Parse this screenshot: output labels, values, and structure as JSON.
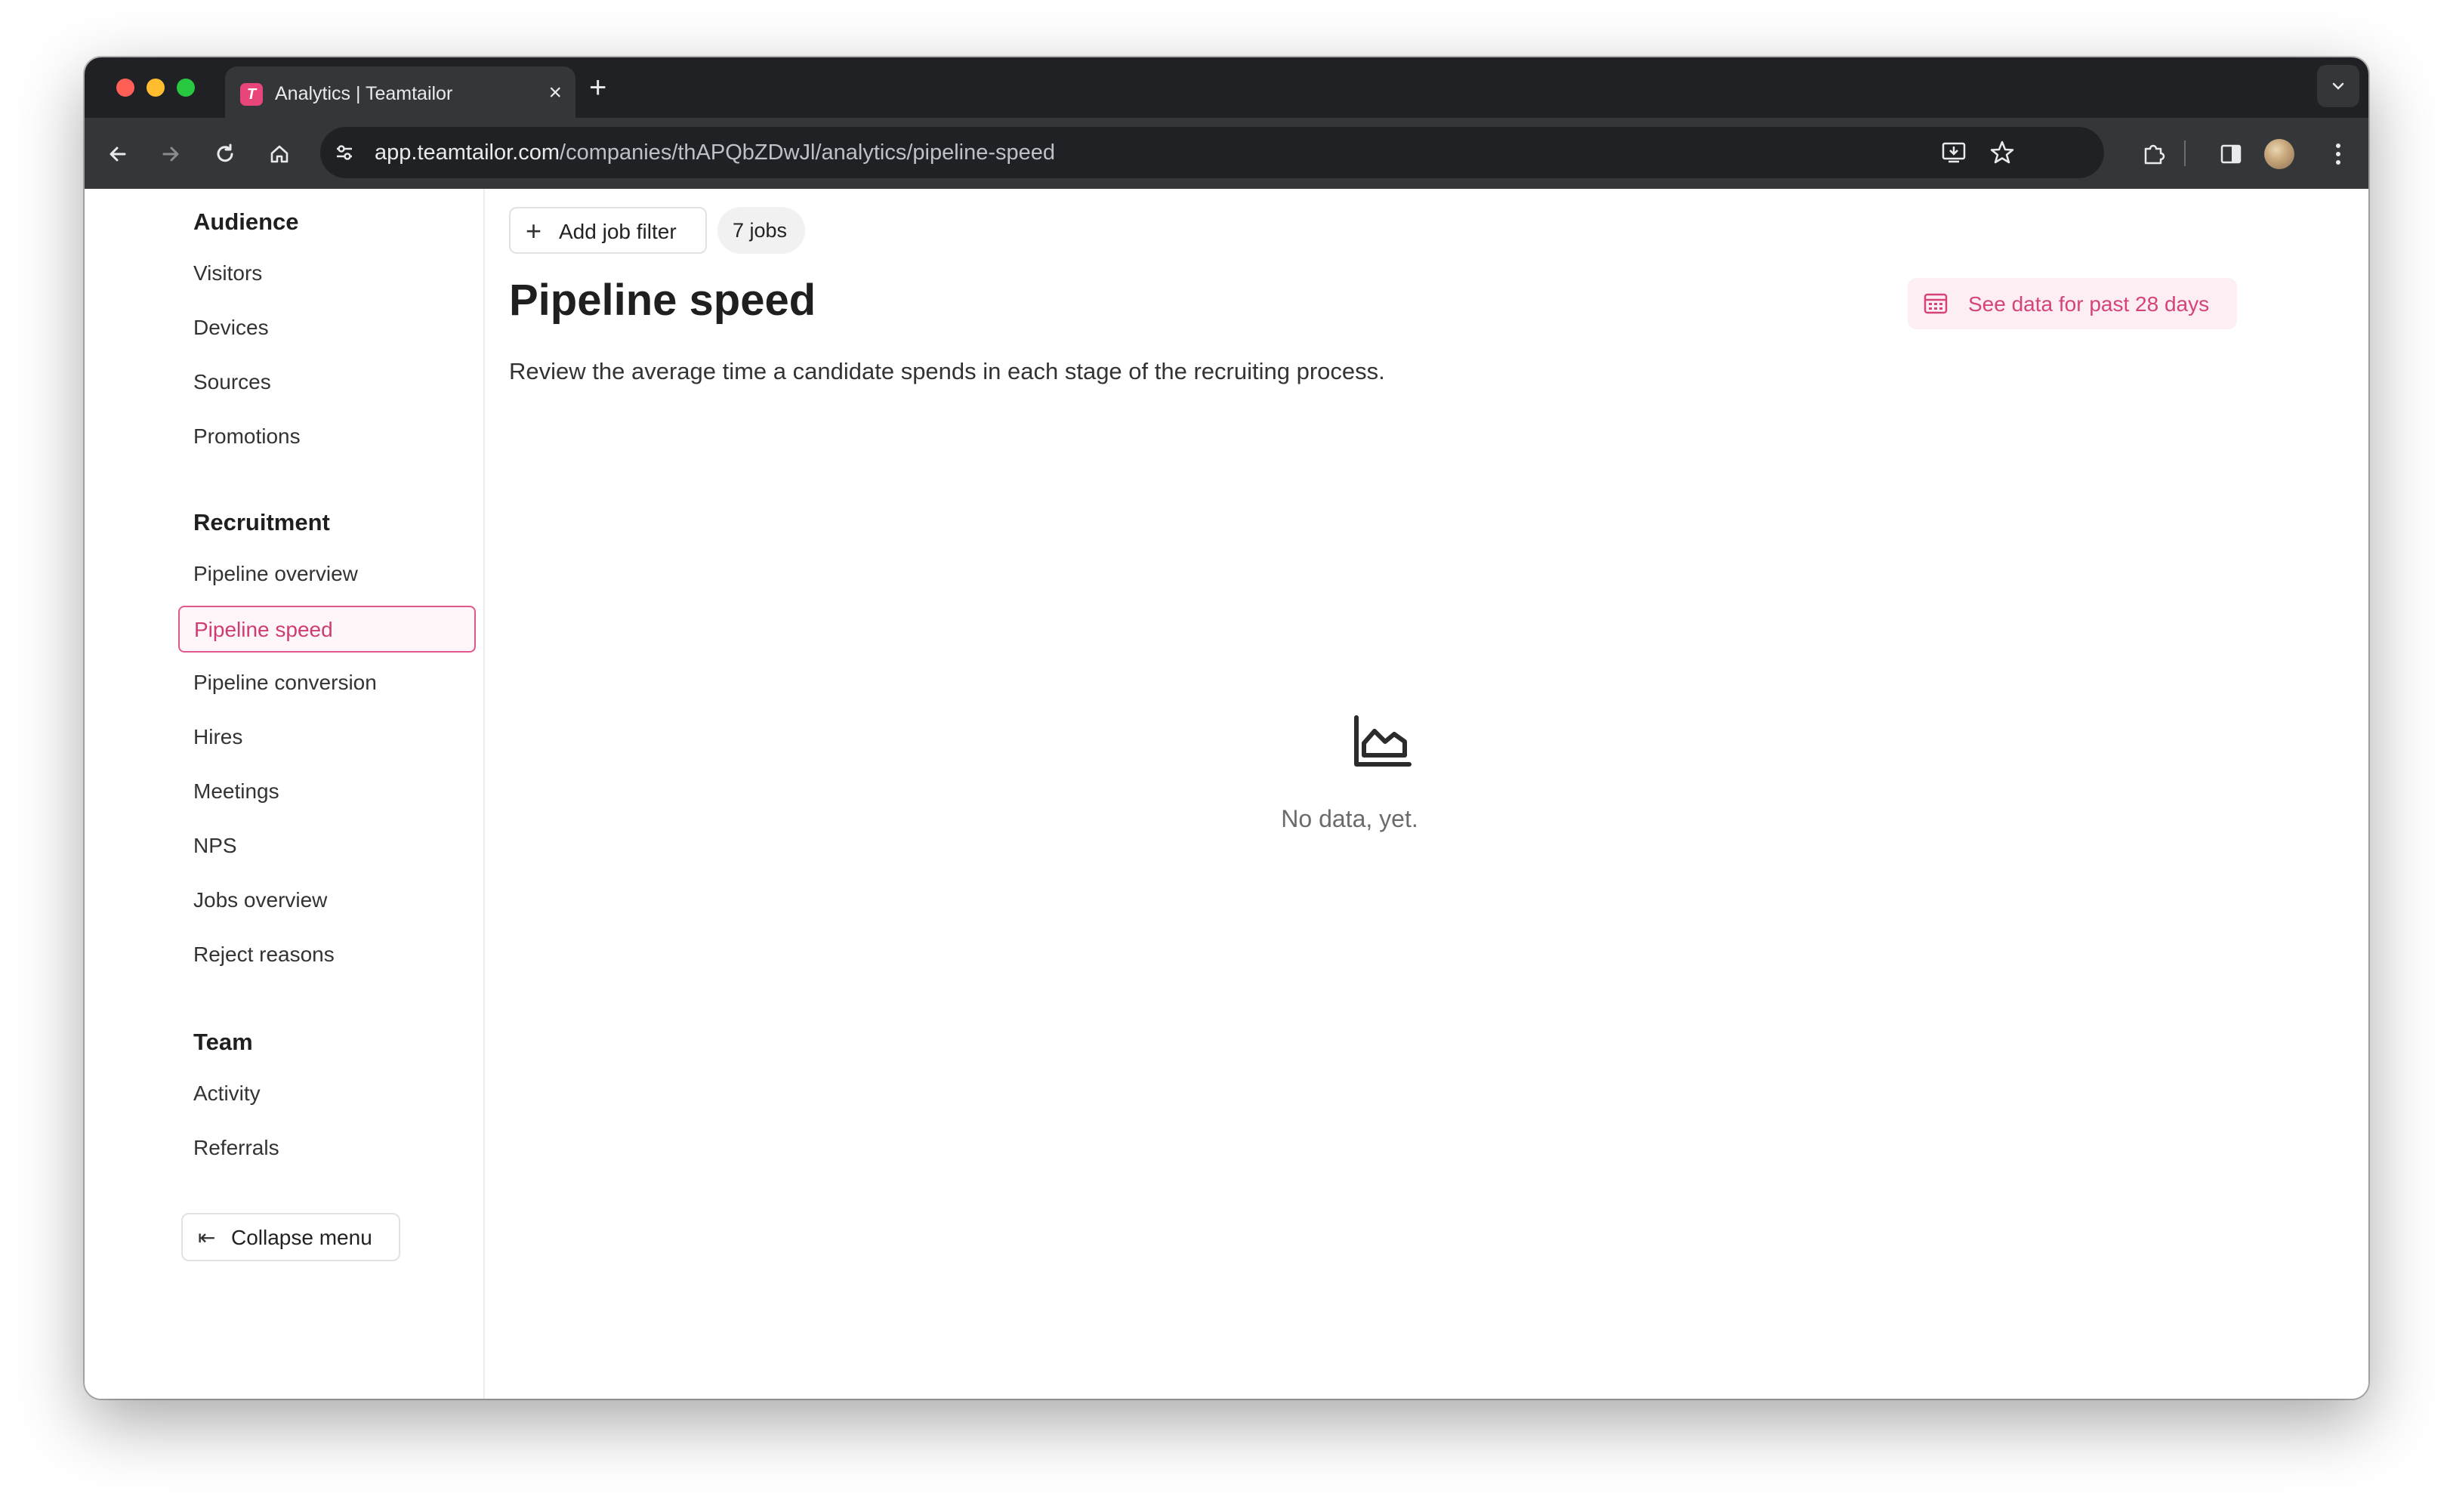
{
  "browser": {
    "tab_title": "Analytics | Teamtailor",
    "tab_favicon": "T",
    "url_host": "app.teamtailor.com",
    "url_path": "/companies/thAPQbZDwJl/analytics/pipeline-speed",
    "traffic_colors": [
      "#ff5f57",
      "#febc2e",
      "#28c840"
    ]
  },
  "sidebar": {
    "sections": [
      {
        "heading": "Audience",
        "items": [
          "Visitors",
          "Devices",
          "Sources",
          "Promotions"
        ]
      },
      {
        "heading": "Recruitment",
        "items": [
          "Pipeline overview",
          "Pipeline speed",
          "Pipeline conversion",
          "Hires",
          "Meetings",
          "NPS",
          "Jobs overview",
          "Reject reasons"
        ]
      },
      {
        "heading": "Team",
        "items": [
          "Activity",
          "Referrals"
        ]
      }
    ],
    "active_item": "Pipeline speed",
    "collapse_label": "Collapse menu"
  },
  "main": {
    "add_filter_label": "Add job filter",
    "jobs_badge": "7 jobs",
    "title": "Pipeline speed",
    "subtitle": "Review the average time a candidate spends in each stage of the recruiting process.",
    "date_range_label": "See data for past 28 days",
    "empty_state": "No data, yet.",
    "empty_icon": "area-chart-icon"
  },
  "colors": {
    "accent": "#e0598c",
    "accent_text": "#d6427a",
    "accent_bg": "#fdeef3"
  }
}
